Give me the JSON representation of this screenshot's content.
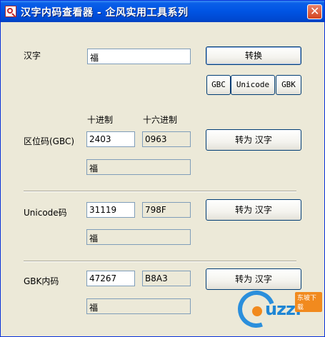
{
  "window": {
    "title": "汉字内码查看器 - 企风实用工具系列",
    "close_glyph": "✕"
  },
  "hanzi": {
    "label": "汉字",
    "value": "福"
  },
  "convert_button": "转换",
  "encoding_buttons": {
    "gbc": "GBC",
    "unicode": "Unicode",
    "gbk": "GBK"
  },
  "column_headers": {
    "decimal": "十进制",
    "hex": "十六进制"
  },
  "qwm": {
    "label": "区位码(GBC)",
    "decimal": "2403",
    "hex": "0963",
    "button": "转为 汉字",
    "result": "福"
  },
  "unicode": {
    "label": "Unicode码",
    "decimal": "31119",
    "hex": "798F",
    "button": "转为 汉字",
    "result": "福"
  },
  "gbk": {
    "label": "GBK内码",
    "decimal": "47267",
    "hex": "B8A3",
    "button": "转为 汉字",
    "result": "福"
  },
  "watermark": {
    "brand": "uzzf",
    "tag": "东坡下载"
  }
}
